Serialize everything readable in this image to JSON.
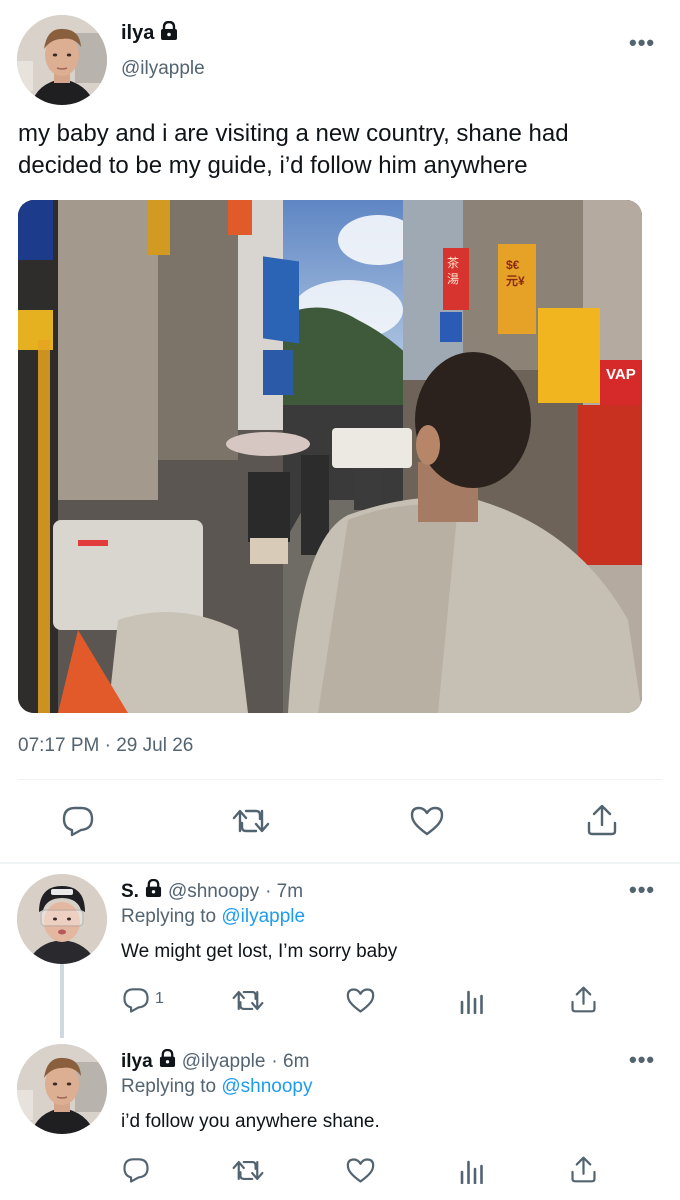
{
  "main_tweet": {
    "author": {
      "name": "ilya",
      "handle": "@ilyapple"
    },
    "text": "my baby and i are visiting a new country, shane had decided to be my guide, i’d follow him anywhere",
    "timestamp": "07:17 PM · 29 Jul 26",
    "photo": {
      "signs": {
        "price": "$€",
        "price2": "元¥",
        "shop_right": "VAP",
        "vertical": "茶 湯"
      }
    },
    "more_label": "•••"
  },
  "replies": [
    {
      "name": "S.",
      "handle": "@shnoopy",
      "time": "· 7m",
      "replying_prefix": "Replying to ",
      "replying_to": "@ilyapple",
      "text": "We might get lost, I’m sorry baby",
      "reply_count": "1"
    },
    {
      "name": "ilya",
      "handle": "@ilyapple",
      "time": "· 6m",
      "replying_prefix": "Replying to ",
      "replying_to": "@shnoopy",
      "text": "i’d follow you anywhere shane."
    }
  ],
  "icons": {
    "reply": "reply-icon",
    "retweet": "retweet-icon",
    "like": "heart-icon",
    "share": "share-icon",
    "analytics": "analytics-icon",
    "lock": "lock-icon",
    "more": "more-icon"
  }
}
